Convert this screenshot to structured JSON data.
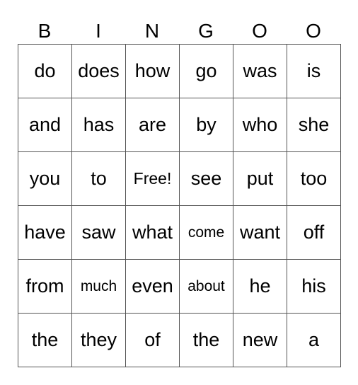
{
  "header": [
    "B",
    "I",
    "N",
    "G",
    "O",
    "O"
  ],
  "free_label": "Free!",
  "rows": [
    [
      "do",
      "does",
      "how",
      "go",
      "was",
      "is"
    ],
    [
      "and",
      "has",
      "are",
      "by",
      "who",
      "she"
    ],
    [
      "you",
      "to",
      "Free!",
      "see",
      "put",
      "too"
    ],
    [
      "have",
      "saw",
      "what",
      "come",
      "want",
      "off"
    ],
    [
      "from",
      "much",
      "even",
      "about",
      "he",
      "his"
    ],
    [
      "the",
      "they",
      "of",
      "the",
      "new",
      "a"
    ]
  ]
}
